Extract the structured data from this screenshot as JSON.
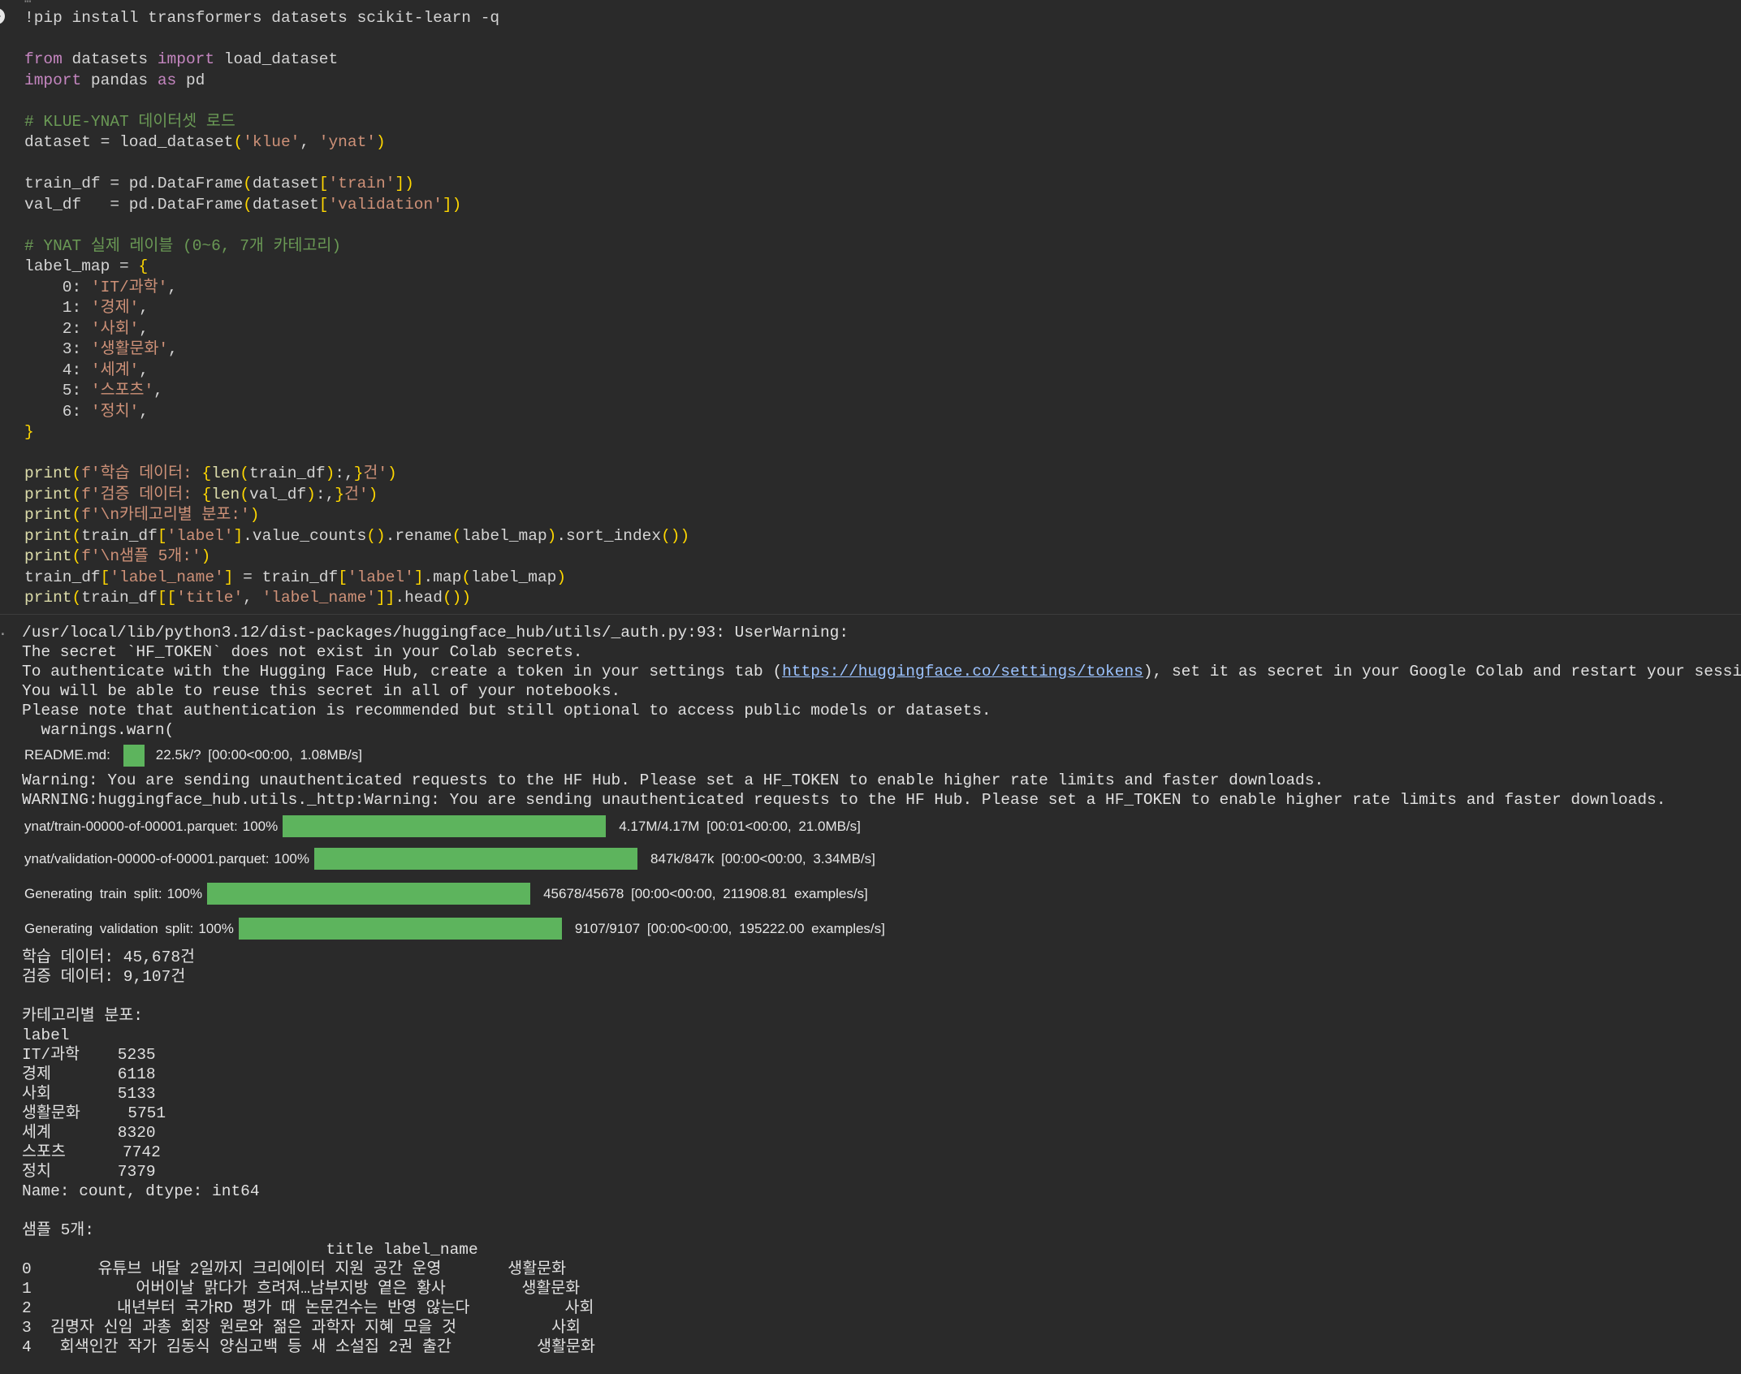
{
  "code": {
    "lines": [
      [
        {
          "t": "!pip install transformers datasets scikit-learn -q",
          "c": "var"
        }
      ],
      [],
      [
        {
          "t": "from",
          "c": "kw"
        },
        {
          "t": " datasets ",
          "c": "var"
        },
        {
          "t": "import",
          "c": "kw"
        },
        {
          "t": " load_dataset",
          "c": "var"
        }
      ],
      [
        {
          "t": "import",
          "c": "kw"
        },
        {
          "t": " pandas ",
          "c": "var"
        },
        {
          "t": "as",
          "c": "kw"
        },
        {
          "t": " pd",
          "c": "var"
        }
      ],
      [],
      [
        {
          "t": "# KLUE-YNAT 데이터셋 로드",
          "c": "cm"
        }
      ],
      [
        {
          "t": "dataset = load_dataset",
          "c": "var"
        },
        {
          "t": "(",
          "c": "pp"
        },
        {
          "t": "'klue'",
          "c": "str"
        },
        {
          "t": ", ",
          "c": "var"
        },
        {
          "t": "'ynat'",
          "c": "str"
        },
        {
          "t": ")",
          "c": "pp"
        }
      ],
      [],
      [
        {
          "t": "train_df = pd.DataFrame",
          "c": "var"
        },
        {
          "t": "(",
          "c": "pp"
        },
        {
          "t": "dataset",
          "c": "var"
        },
        {
          "t": "[",
          "c": "pp"
        },
        {
          "t": "'train'",
          "c": "str"
        },
        {
          "t": "]",
          "c": "pp"
        },
        {
          "t": ")",
          "c": "pp"
        }
      ],
      [
        {
          "t": "val_df   = pd.DataFrame",
          "c": "var"
        },
        {
          "t": "(",
          "c": "pp"
        },
        {
          "t": "dataset",
          "c": "var"
        },
        {
          "t": "[",
          "c": "pp"
        },
        {
          "t": "'validation'",
          "c": "str"
        },
        {
          "t": "]",
          "c": "pp"
        },
        {
          "t": ")",
          "c": "pp"
        }
      ],
      [],
      [
        {
          "t": "# YNAT 실제 레이블 (0~6, 7개 카테고리)",
          "c": "cm"
        }
      ],
      [
        {
          "t": "label_map = ",
          "c": "var"
        },
        {
          "t": "{",
          "c": "pp"
        }
      ],
      [
        {
          "t": "    0: ",
          "c": "var"
        },
        {
          "t": "'IT/과학'",
          "c": "str"
        },
        {
          "t": ",",
          "c": "var"
        }
      ],
      [
        {
          "t": "    1: ",
          "c": "var"
        },
        {
          "t": "'경제'",
          "c": "str"
        },
        {
          "t": ",",
          "c": "var"
        }
      ],
      [
        {
          "t": "    2: ",
          "c": "var"
        },
        {
          "t": "'사회'",
          "c": "str"
        },
        {
          "t": ",",
          "c": "var"
        }
      ],
      [
        {
          "t": "    3: ",
          "c": "var"
        },
        {
          "t": "'생활문화'",
          "c": "str"
        },
        {
          "t": ",",
          "c": "var"
        }
      ],
      [
        {
          "t": "    4: ",
          "c": "var"
        },
        {
          "t": "'세계'",
          "c": "str"
        },
        {
          "t": ",",
          "c": "var"
        }
      ],
      [
        {
          "t": "    5: ",
          "c": "var"
        },
        {
          "t": "'스포츠'",
          "c": "str"
        },
        {
          "t": ",",
          "c": "var"
        }
      ],
      [
        {
          "t": "    6: ",
          "c": "var"
        },
        {
          "t": "'정치'",
          "c": "str"
        },
        {
          "t": ",",
          "c": "var"
        }
      ],
      [
        {
          "t": "}",
          "c": "pp"
        }
      ],
      [],
      [
        {
          "t": "print",
          "c": "fn"
        },
        {
          "t": "(",
          "c": "pp"
        },
        {
          "t": "f'학습 데이터: ",
          "c": "str"
        },
        {
          "t": "{",
          "c": "pp"
        },
        {
          "t": "len",
          "c": "fn"
        },
        {
          "t": "(",
          "c": "pp"
        },
        {
          "t": "train_df",
          "c": "var"
        },
        {
          "t": ")",
          "c": "pp"
        },
        {
          "t": ":,",
          "c": "var"
        },
        {
          "t": "}",
          "c": "pp"
        },
        {
          "t": "건'",
          "c": "str"
        },
        {
          "t": ")",
          "c": "pp"
        }
      ],
      [
        {
          "t": "print",
          "c": "fn"
        },
        {
          "t": "(",
          "c": "pp"
        },
        {
          "t": "f'검증 데이터: ",
          "c": "str"
        },
        {
          "t": "{",
          "c": "pp"
        },
        {
          "t": "len",
          "c": "fn"
        },
        {
          "t": "(",
          "c": "pp"
        },
        {
          "t": "val_df",
          "c": "var"
        },
        {
          "t": ")",
          "c": "pp"
        },
        {
          "t": ":,",
          "c": "var"
        },
        {
          "t": "}",
          "c": "pp"
        },
        {
          "t": "건'",
          "c": "str"
        },
        {
          "t": ")",
          "c": "pp"
        }
      ],
      [
        {
          "t": "print",
          "c": "fn"
        },
        {
          "t": "(",
          "c": "pp"
        },
        {
          "t": "f'\\n카테고리별 분포:'",
          "c": "str"
        },
        {
          "t": ")",
          "c": "pp"
        }
      ],
      [
        {
          "t": "print",
          "c": "fn"
        },
        {
          "t": "(",
          "c": "pp"
        },
        {
          "t": "train_df",
          "c": "var"
        },
        {
          "t": "[",
          "c": "pp"
        },
        {
          "t": "'label'",
          "c": "str"
        },
        {
          "t": "]",
          "c": "pp"
        },
        {
          "t": ".value_counts",
          "c": "var"
        },
        {
          "t": "()",
          "c": "pp"
        },
        {
          "t": ".rename",
          "c": "var"
        },
        {
          "t": "(",
          "c": "pp"
        },
        {
          "t": "label_map",
          "c": "var"
        },
        {
          "t": ")",
          "c": "pp"
        },
        {
          "t": ".sort_index",
          "c": "var"
        },
        {
          "t": "()",
          "c": "pp"
        },
        {
          "t": ")",
          "c": "pp"
        }
      ],
      [
        {
          "t": "print",
          "c": "fn"
        },
        {
          "t": "(",
          "c": "pp"
        },
        {
          "t": "f'\\n샘플 5개:'",
          "c": "str"
        },
        {
          "t": ")",
          "c": "pp"
        }
      ],
      [
        {
          "t": "train_df",
          "c": "var"
        },
        {
          "t": "[",
          "c": "pp"
        },
        {
          "t": "'label_name'",
          "c": "str"
        },
        {
          "t": "]",
          "c": "pp"
        },
        {
          "t": " = train_df",
          "c": "var"
        },
        {
          "t": "[",
          "c": "pp"
        },
        {
          "t": "'label'",
          "c": "str"
        },
        {
          "t": "]",
          "c": "pp"
        },
        {
          "t": ".map",
          "c": "var"
        },
        {
          "t": "(",
          "c": "pp"
        },
        {
          "t": "label_map",
          "c": "var"
        },
        {
          "t": ")",
          "c": "pp"
        }
      ],
      [
        {
          "t": "print",
          "c": "fn"
        },
        {
          "t": "(",
          "c": "pp"
        },
        {
          "t": "train_df",
          "c": "var"
        },
        {
          "t": "[[",
          "c": "pp"
        },
        {
          "t": "'title'",
          "c": "str"
        },
        {
          "t": ", ",
          "c": "var"
        },
        {
          "t": "'label_name'",
          "c": "str"
        },
        {
          "t": "]]",
          "c": "pp"
        },
        {
          "t": ".head",
          "c": "var"
        },
        {
          "t": "()",
          "c": "pp"
        },
        {
          "t": ")",
          "c": "pp"
        }
      ]
    ]
  },
  "output": {
    "warn_path": "/usr/local/lib/python3.12/dist-packages/huggingface_hub/utils/_auth.py:93: UserWarning:",
    "warn_line1": "The secret `HF_TOKEN` does not exist in your Colab secrets.",
    "warn_line2_pre": "To authenticate with the Hugging Face Hub, create a token in your settings tab (",
    "warn_link": "https://huggingface.co/settings/tokens",
    "warn_line2_post": "), set it as secret in your Google Colab and restart your session.",
    "warn_line3": "You will be able to reuse this secret in all of your notebooks.",
    "warn_line4": "Please note that authentication is recommended but still optional to access public models or datasets.",
    "warn_line5": "  warnings.warn(",
    "readme": {
      "label": "README.md:",
      "stats": "22.5k/? [00:00<00:00,  1.08MB/s]"
    },
    "unauth1": "Warning: You are sending unauthenticated requests to the HF Hub. Please set a HF_TOKEN to enable higher rate limits and faster downloads.",
    "unauth2": "WARNING:huggingface_hub.utils._http:Warning: You are sending unauthenticated requests to the HF Hub. Please set a HF_TOKEN to enable higher rate limits and faster downloads.",
    "progress": [
      {
        "label": "ynat/train-00000-of-00001.parquet:",
        "pct": "100%",
        "fill": 1.0,
        "stats": "4.17M/4.17M  [00:01<00:00,  21.0MB/s]"
      },
      {
        "label": "ynat/validation-00000-of-00001.parquet:",
        "pct": "100%",
        "fill": 1.0,
        "stats": "847k/847k  [00:00<00:00,  3.34MB/s]"
      },
      {
        "label": "Generating train split:",
        "pct": "100%",
        "fill": 1.0,
        "stats": "45678/45678  [00:00<00:00, 211908.81 examples/s]"
      },
      {
        "label": "Generating validation split:",
        "pct": "100%",
        "fill": 1.0,
        "stats": "9107/9107  [00:00<00:00, 195222.00 examples/s]"
      }
    ],
    "result_text": "학습 데이터: 45,678건\n검증 데이터: 9,107건\n\n카테고리별 분포:\nlabel\nIT/과학    5235\n경제       6118\n사회       5133\n생활문화     5751\n세계       8320\n스포츠      7742\n정치       7379\nName: count, dtype: int64\n\n샘플 5개:\n                                title label_name\n0       유튜브 내달 2일까지 크리에이터 지원 공간 운영       생활문화\n1           어버이날 맑다가 흐려져…남부지방 옅은 황사        생활문화\n2         내년부터 국가RD 평가 때 논문건수는 반영 않는다          사회\n3  김명자 신임 과총 회장 원로와 젊은 과학자 지혜 모을 것          사회\n4   회색인간 작가 김동식 양심고백 등 새 소설집 2권 출간         생활문화"
  }
}
